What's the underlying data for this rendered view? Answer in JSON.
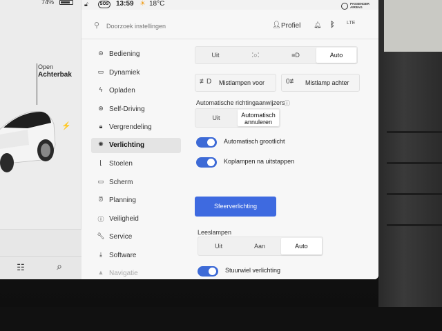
{
  "status": {
    "battery_pct": "74%",
    "sos_label": "SOS",
    "time": "13:59",
    "temperature": "18°C",
    "airbag_line1": "PASSENGER",
    "airbag_line2": "AIRBAG"
  },
  "car": {
    "trunk_state": "Open",
    "trunk_name": "Achterbak"
  },
  "settings": {
    "search_placeholder": "Doorzoek instellingen",
    "profile_label": "Profiel",
    "lte_label": "LTE"
  },
  "menu": {
    "items": [
      {
        "label": "Bediening",
        "icon": "toggle-icon"
      },
      {
        "label": "Dynamiek",
        "icon": "car-icon"
      },
      {
        "label": "Opladen",
        "icon": "bolt-icon"
      },
      {
        "label": "Self-Driving",
        "icon": "steering-wheel-icon"
      },
      {
        "label": "Vergrendeling",
        "icon": "lock-icon"
      },
      {
        "label": "Verlichting",
        "icon": "light-icon"
      },
      {
        "label": "Stoelen",
        "icon": "seat-icon"
      },
      {
        "label": "Scherm",
        "icon": "display-icon"
      },
      {
        "label": "Planning",
        "icon": "alarm-icon"
      },
      {
        "label": "Veiligheid",
        "icon": "shield-icon"
      },
      {
        "label": "Service",
        "icon": "wrench-icon"
      },
      {
        "label": "Software",
        "icon": "download-icon"
      },
      {
        "label": "Navigatie",
        "icon": "navigation-icon"
      }
    ],
    "active_index": 5
  },
  "lighting": {
    "headlight_mode_options": [
      "Uit",
      "",
      "",
      "Auto"
    ],
    "headlight_mode_selected": "Auto",
    "fog_front_label": "Mistlampen voor",
    "fog_rear_label": "Mistlamp achter",
    "auto_indicators_title": "Automatische richtingaanwijzers",
    "auto_indicators_options": [
      "Uit",
      "Automatisch annuleren"
    ],
    "auto_indicators_selected": "Automatisch annuleren",
    "auto_high_beam_label": "Automatisch grootlicht",
    "auto_high_beam_on": true,
    "headlights_after_exit_label": "Koplampen na uitstappen",
    "headlights_after_exit_on": true,
    "ambient_button_label": "Sfeerverlichting",
    "reading_lights_title": "Leeslampen",
    "reading_lights_options": [
      "Uit",
      "Aan",
      "Auto"
    ],
    "reading_lights_selected": "Auto",
    "steering_wheel_light_label": "Stuurwiel verlichting",
    "steering_wheel_light_on": true
  }
}
